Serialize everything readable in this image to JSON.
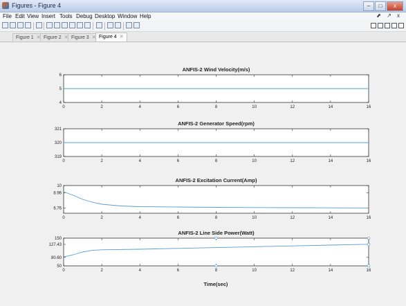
{
  "window": {
    "title": "Figures - Figure 4"
  },
  "window_controls": {
    "minimize": "–",
    "maximize": "□",
    "close": "x"
  },
  "menu": [
    "File",
    "Edit",
    "View",
    "Insert",
    "Tools",
    "Debug",
    "Desktop",
    "Window",
    "Help"
  ],
  "menu_right": "⬈ ↗ x",
  "toolbar": {
    "left_icons": [
      "new-figure-icon",
      "open-icon",
      "save-icon",
      "print-icon",
      "select-icon",
      "zoom-in-icon",
      "zoom-out-icon",
      "pan-icon",
      "rotate-icon",
      "data-cursor-icon",
      "brush-icon",
      "link-icon",
      "colorbar-icon",
      "legend-icon",
      "hide-tools-icon",
      "show-tools-icon"
    ],
    "right_icons": [
      "tile-icon",
      "left-right-icon",
      "top-bottom-icon",
      "float-icon",
      "dock-icon"
    ]
  },
  "tabs": [
    {
      "label": "Figure 1",
      "active": false
    },
    {
      "label": "Figure 2",
      "active": false
    },
    {
      "label": "Figure 3",
      "active": false
    },
    {
      "label": "Figure 4",
      "active": true
    }
  ],
  "colors": {
    "line": "#5b9bd5",
    "axis": "#333333",
    "background": "#f0f0f0",
    "plot_bg": "#ffffff"
  },
  "xlabel": "Time(sec)",
  "chart_data": [
    {
      "type": "line",
      "title": "ANFIS-2 Wind Velocity(m/s)",
      "xlim": [
        0,
        16
      ],
      "ylim": [
        4,
        6
      ],
      "xticks": [
        "0",
        "2",
        "4",
        "6",
        "8",
        "10",
        "12",
        "14",
        "16"
      ],
      "yticks": [
        "4",
        "5",
        "6"
      ],
      "series": [
        {
          "x": [
            0,
            16
          ],
          "y": [
            5,
            5
          ]
        }
      ]
    },
    {
      "type": "line",
      "title": "ANFIS-2 Generator Speed(rpm)",
      "xlim": [
        0,
        16
      ],
      "ylim": [
        319,
        321
      ],
      "xticks": [
        "0",
        "2",
        "4",
        "6",
        "8",
        "10",
        "12",
        "14",
        "16"
      ],
      "yticks": [
        "319",
        "320",
        "321"
      ],
      "series": [
        {
          "x": [
            0,
            16
          ],
          "y": [
            320,
            320
          ]
        }
      ]
    },
    {
      "type": "line",
      "title": "ANFIS-2 Excitation Current(Amp)",
      "xlim": [
        0,
        16
      ],
      "ylim": [
        6.0,
        10
      ],
      "xticks": [
        "0",
        "2",
        "4",
        "6",
        "8",
        "10",
        "12",
        "14",
        "16"
      ],
      "yticks": [
        "6.76",
        "8.96",
        "10"
      ],
      "series": [
        {
          "x": [
            0,
            0.5,
            1,
            1.5,
            2,
            3,
            4,
            6,
            8,
            10,
            12,
            14,
            16
          ],
          "y": [
            9.1,
            8.6,
            8.0,
            7.6,
            7.3,
            7.05,
            6.95,
            6.9,
            6.85,
            6.82,
            6.8,
            6.78,
            6.76
          ]
        }
      ]
    },
    {
      "type": "line",
      "title": "ANFIS-2 Line Side Power(Watt)",
      "xlim": [
        0,
        16
      ],
      "ylim": [
        50,
        150
      ],
      "xticks": [
        "0",
        "2",
        "4",
        "6",
        "8",
        "10",
        "12",
        "14",
        "16"
      ],
      "yticks": [
        "50",
        "80.60",
        "127.43",
        "150"
      ],
      "series": [
        {
          "x": [
            0,
            0.5,
            1,
            1.5,
            2,
            4,
            6,
            8,
            10,
            12,
            14,
            16
          ],
          "y": [
            82,
            90,
            100,
            106,
            108,
            110,
            113,
            116,
            119,
            122,
            125,
            128
          ]
        }
      ],
      "markers": [
        {
          "x": 8,
          "y": 150
        },
        {
          "x": 8,
          "y": 50
        },
        {
          "x": 16,
          "y": 150
        },
        {
          "x": 16,
          "y": 127.43
        },
        {
          "x": 16,
          "y": 50
        }
      ]
    }
  ]
}
